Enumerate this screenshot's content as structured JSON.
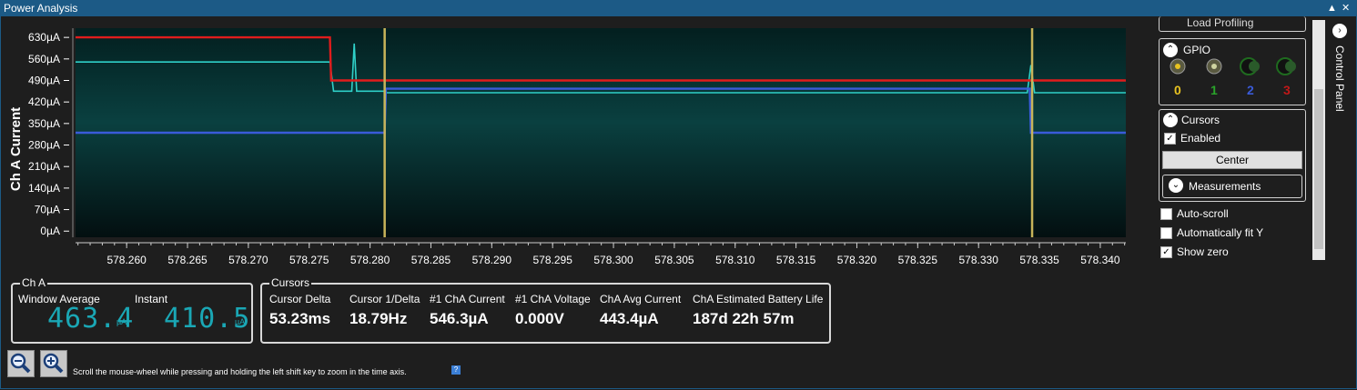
{
  "window": {
    "title": "Power Analysis",
    "btn_up": "▲",
    "btn_close": "✕"
  },
  "chart_data": {
    "type": "line",
    "ylabel": "Ch A Current",
    "xlabel": "",
    "y_ticks": [
      "630µA",
      "560µA",
      "490µA",
      "420µA",
      "350µA",
      "280µA",
      "210µA",
      "140µA",
      "70µA",
      "0µA"
    ],
    "x_ticks": [
      "578.260",
      "578.265",
      "578.270",
      "578.275",
      "578.280",
      "578.285",
      "578.290",
      "578.295",
      "578.300",
      "578.305",
      "578.310",
      "578.315",
      "578.320",
      "578.325",
      "578.330",
      "578.335",
      "578.340"
    ],
    "xlim": [
      578.2558,
      578.3421
    ],
    "ylim": [
      -20,
      660
    ],
    "series": [
      {
        "color": "#2fd0c8",
        "points": [
          [
            578.2558,
            550
          ],
          [
            578.2767,
            550
          ],
          [
            578.277,
            455
          ],
          [
            578.2785,
            455
          ],
          [
            578.2787,
            610
          ],
          [
            578.2789,
            455
          ],
          [
            578.2812,
            455
          ],
          [
            578.2814,
            450
          ],
          [
            578.334,
            450
          ],
          [
            578.3343,
            540
          ],
          [
            578.3346,
            450
          ],
          [
            578.3421,
            450
          ]
        ]
      },
      {
        "color": "#e01c1c",
        "points": [
          [
            578.2558,
            630
          ],
          [
            578.2767,
            630
          ],
          [
            578.2768,
            490
          ],
          [
            578.3421,
            490
          ]
        ]
      },
      {
        "color": "#3a5bd9",
        "points": [
          [
            578.2558,
            320
          ],
          [
            578.2812,
            320
          ],
          [
            578.2813,
            463
          ],
          [
            578.3342,
            463
          ],
          [
            578.3343,
            320
          ],
          [
            578.3421,
            320
          ]
        ]
      }
    ],
    "cursors": [
      578.2812,
      578.3344
    ],
    "colors": {
      "cursor": "#c8b45a",
      "background": "#062828"
    }
  },
  "cha": {
    "legend": "Ch A",
    "window_average_label": "Window Average",
    "instant_label": "Instant",
    "window_average_value": "463.4",
    "instant_value": "410.5",
    "unit": "µA"
  },
  "cursors_group": {
    "legend": "Cursors",
    "fields": [
      {
        "label": "Cursor Delta",
        "value": "53.23ms"
      },
      {
        "label": "Cursor 1/Delta",
        "value": "18.79Hz"
      },
      {
        "label": "#1 ChA Current",
        "value": "546.3µA"
      },
      {
        "label": "#1 ChA Voltage",
        "value": "0.000V"
      },
      {
        "label": "ChA Avg Current",
        "value": "443.4µA"
      },
      {
        "label": "ChA Estimated Battery Life",
        "value": "187d 22h 57m"
      }
    ]
  },
  "hint": "Scroll the mouse-wheel while pressing and holding the left shift key to zoom in the time axis.",
  "help": "?",
  "control_panel": {
    "tab_label": "Control Panel",
    "top_partial": "Load Profiling",
    "gpio_title": "GPIO",
    "gpio": [
      {
        "num": "0",
        "color": "#e8c320"
      },
      {
        "num": "1",
        "color": "#2aa52a"
      },
      {
        "num": "2",
        "color": "#3a5bd9"
      },
      {
        "num": "3",
        "color": "#c01818"
      }
    ],
    "cursors_title": "Cursors",
    "enabled_label": "Enabled",
    "center_label": "Center",
    "measurements_label": "Measurements",
    "auto_scroll_label": "Auto-scroll",
    "auto_fit_label": "Automatically fit Y",
    "show_zero_label": "Show zero",
    "check": "✓"
  }
}
